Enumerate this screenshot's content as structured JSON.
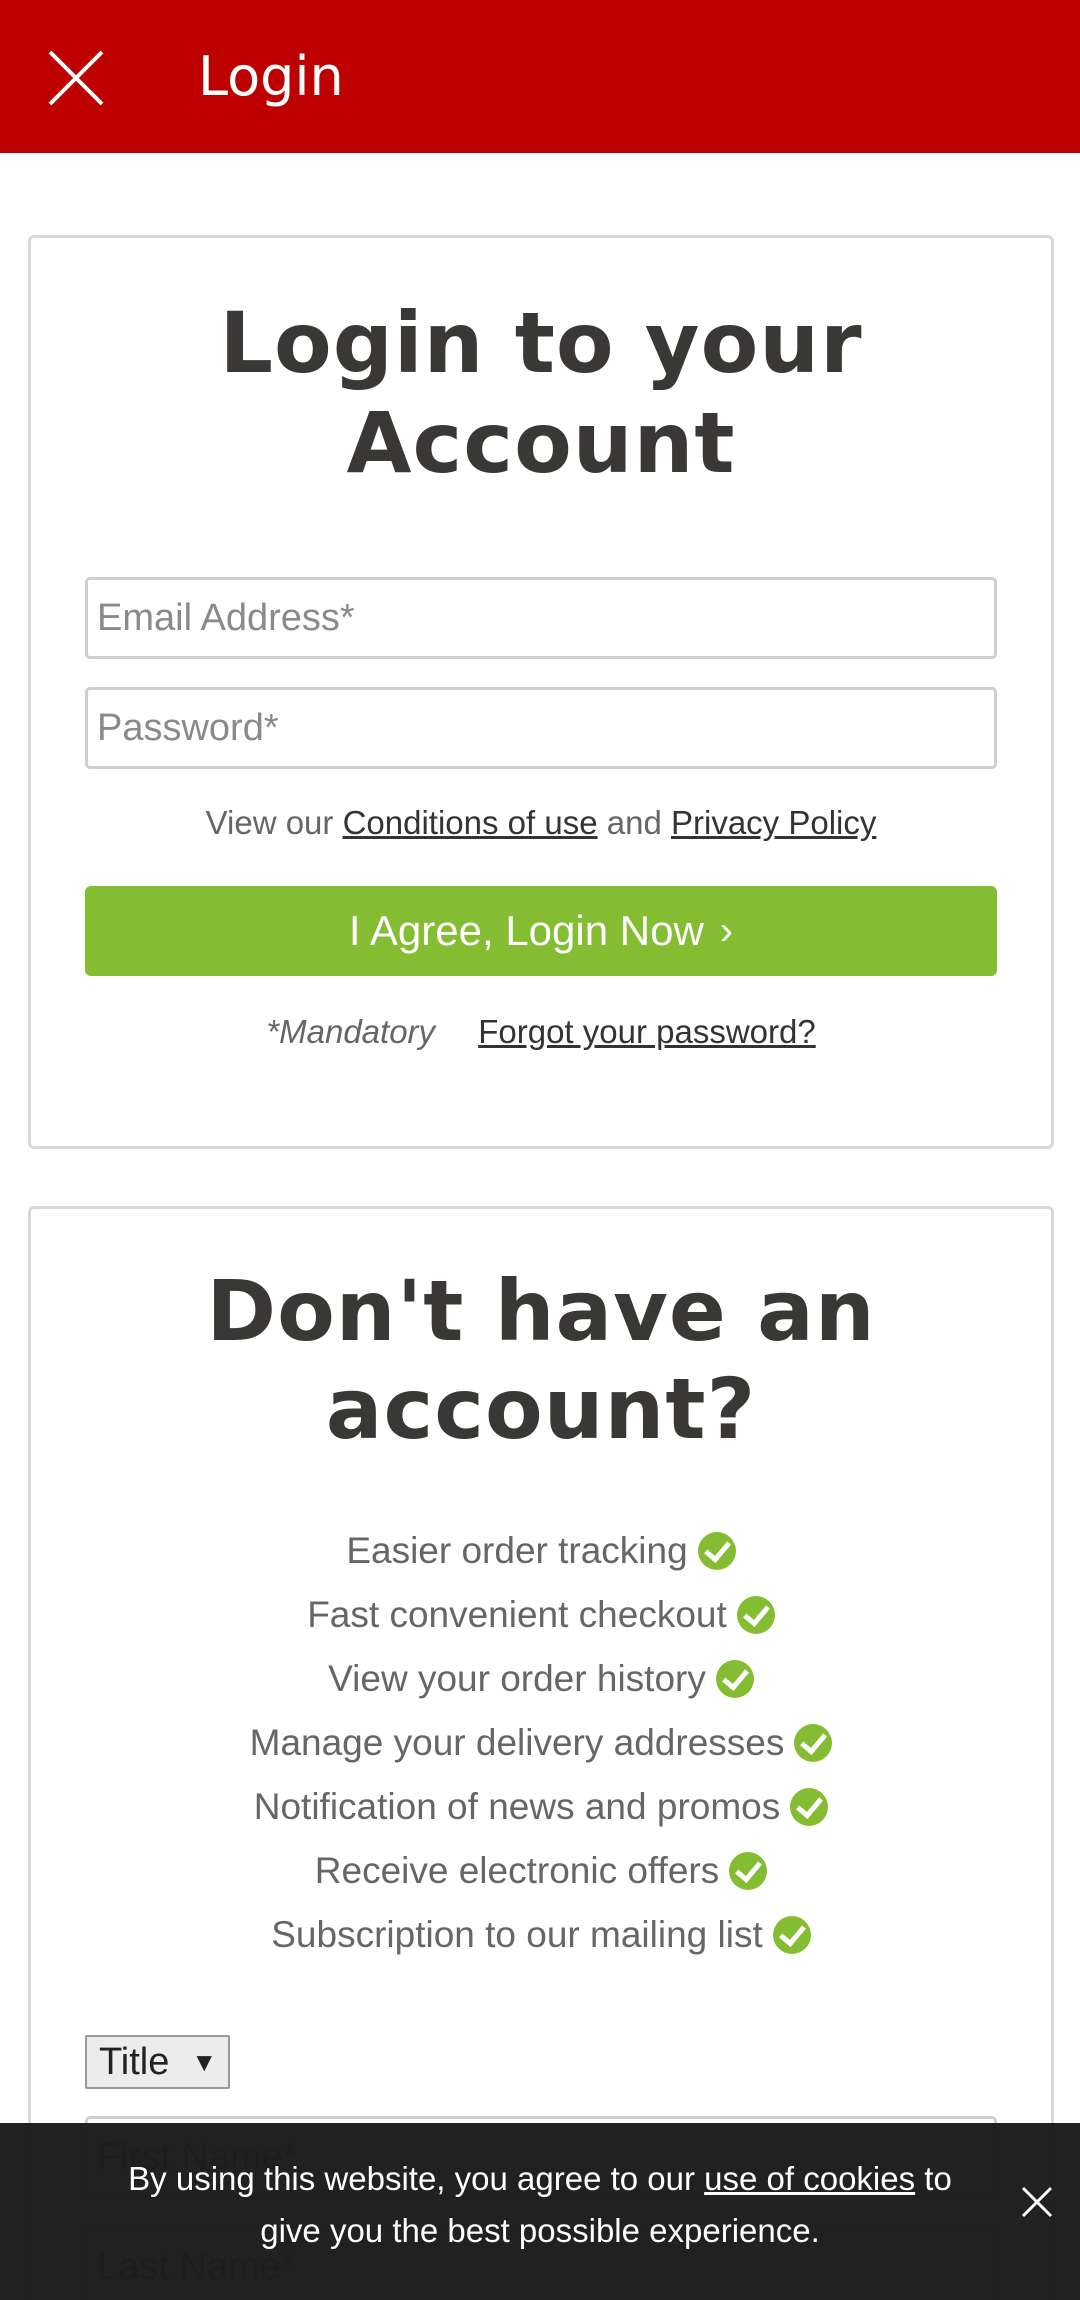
{
  "appbar": {
    "title": "Login",
    "close_icon": "close-icon"
  },
  "login": {
    "heading_line1": "Login to your",
    "heading_line2": "Account",
    "email_placeholder": "Email Address*",
    "password_placeholder": "Password*",
    "terms_prefix": "View our ",
    "terms_link": "Conditions of use",
    "terms_and": " and ",
    "privacy_link": "Privacy Policy",
    "submit_label": "I Agree, Login Now",
    "mandatory": "*Mandatory",
    "forgot": "Forgot your password?"
  },
  "register": {
    "heading_line1": "Don't have an",
    "heading_line2": "account?",
    "benefits": [
      "Easier order tracking",
      "Fast convenient checkout",
      "View your order history",
      "Manage your delivery addresses",
      "Notification of news and promos",
      "Receive electronic offers",
      "Subscription to our mailing list"
    ],
    "title_select": "Title",
    "first_name_placeholder": "First Name*",
    "last_name_placeholder": "Last Name*"
  },
  "cookie": {
    "text_before": "By using this website, you agree to our ",
    "link": "use of cookies",
    "text_after": " to give you the best possible experience."
  },
  "colors": {
    "brand_red": "#bd0000",
    "accent_green": "#84bd32",
    "heading": "#3a3835"
  }
}
